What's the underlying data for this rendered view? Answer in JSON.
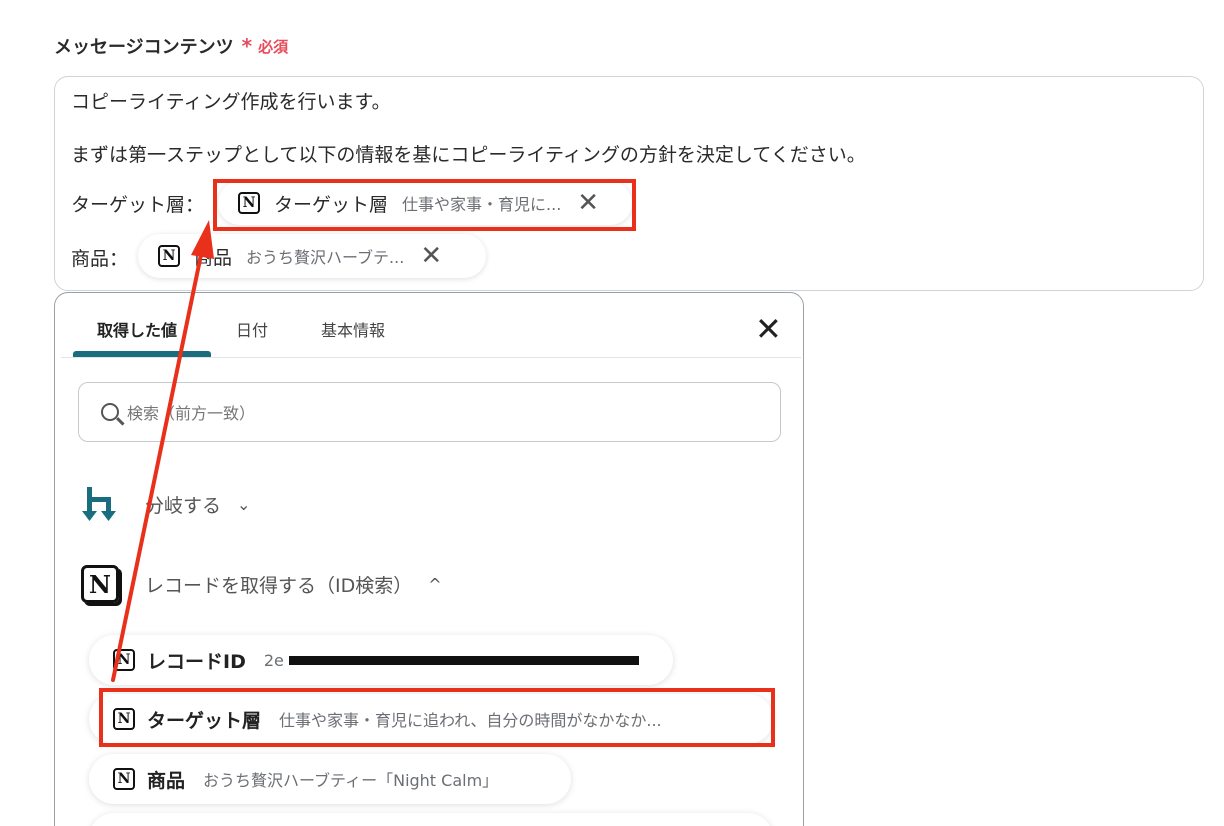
{
  "field": {
    "label": "メッセージコンテンツ",
    "required_star": "*",
    "required_text": "必須"
  },
  "editor": {
    "line1": "コピーライティング作成を行います。",
    "line2": "まずは第一ステップとして以下の情報を基にコピーライティングの方針を決定してください。",
    "line3_prefix": "ターゲット層：",
    "line4_prefix": "商品：",
    "chips": [
      {
        "label": "ターゲット層",
        "value": "仕事や家事・育児に...",
        "close": "✕"
      },
      {
        "label": "商品",
        "value": "おうち贅沢ハーブテ...",
        "close": "✕"
      }
    ]
  },
  "panel": {
    "tabs": [
      {
        "label": "取得した値",
        "active": true
      },
      {
        "label": "日付",
        "active": false
      },
      {
        "label": "基本情報",
        "active": false
      }
    ],
    "close": "✕",
    "search_placeholder": "検索（前方一致）",
    "groups": [
      {
        "label": "分岐する",
        "expanded": false,
        "icon": "branch-icon",
        "chevron": "⌄"
      },
      {
        "label": "レコードを取得する（ID検索）",
        "expanded": true,
        "icon": "notion-icon",
        "chevron": "^"
      }
    ],
    "items": [
      {
        "label": "レコードID",
        "value": "2e",
        "redacted": true
      },
      {
        "label": "ターゲット層",
        "value": "仕事や家事・育児に追われ、自分の時間がなかなか..."
      },
      {
        "label": "商品",
        "value": "おうち贅沢ハーブティー「Night Calm」"
      },
      {
        "label": "",
        "value": ""
      }
    ]
  },
  "icons": {
    "notion_letter": "N"
  },
  "colors": {
    "required": "#e74c5b",
    "highlight": "#e8301b",
    "tab_accent": "#1a6d7e",
    "branch": "#1a6d7e"
  }
}
